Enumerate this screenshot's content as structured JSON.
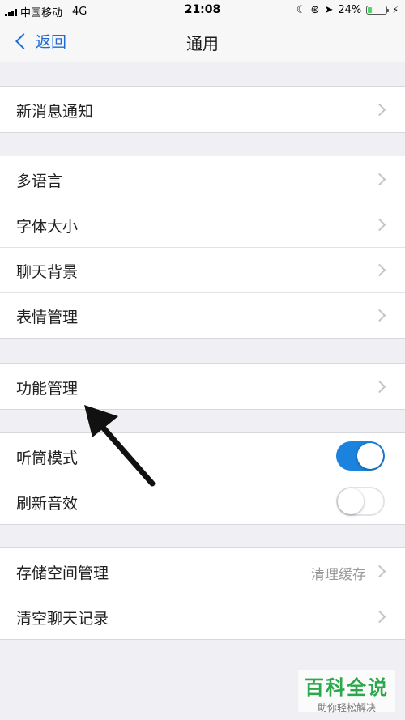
{
  "status_bar": {
    "carrier": "中国移动",
    "network": "4G",
    "time": "21:08",
    "battery_percent": "24%",
    "battery_level": 0.24
  },
  "nav": {
    "back_label": "返回",
    "title": "通用"
  },
  "groups": [
    {
      "items": [
        {
          "label": "新消息通知"
        }
      ]
    },
    {
      "items": [
        {
          "label": "多语言"
        },
        {
          "label": "字体大小"
        },
        {
          "label": "聊天背景"
        },
        {
          "label": "表情管理"
        }
      ]
    },
    {
      "items": [
        {
          "label": "功能管理"
        }
      ]
    },
    {
      "items": [
        {
          "label": "听筒模式",
          "toggle": true
        },
        {
          "label": "刷新音效",
          "toggle": false
        }
      ]
    },
    {
      "items": [
        {
          "label": "存储空间管理",
          "detail": "清理缓存"
        },
        {
          "label": "清空聊天记录"
        }
      ]
    }
  ],
  "watermark": {
    "title": "百科全说",
    "subtitle": "助你轻松解决"
  },
  "colors": {
    "accent": "#1e6bd6",
    "toggle_on": "#1b82de",
    "battery": "#4cd964",
    "watermark": "#2ba84a"
  }
}
